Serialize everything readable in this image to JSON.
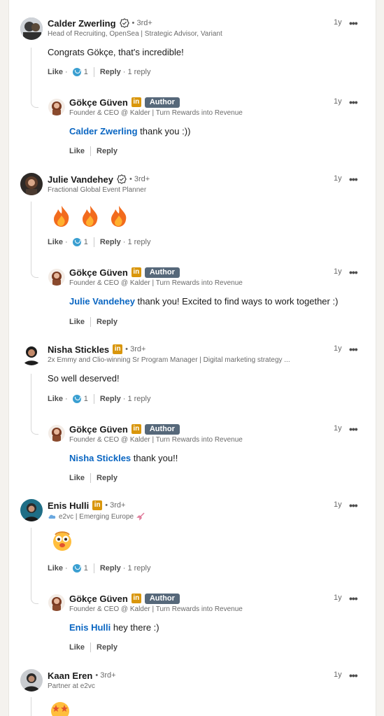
{
  "colors": {
    "link": "#0a66c2",
    "author_badge": "#56687a",
    "linkedin_badge": "#d9960b",
    "reaction": "#3a9fd1"
  },
  "labels": {
    "like": "Like",
    "reply": "Reply",
    "dot": "·",
    "bullet": "•",
    "author": "Author",
    "in": "in",
    "more": "•••"
  },
  "comments": [
    {
      "name": "Calder Zwerling",
      "degree": "3rd+",
      "badge": "verified-icon",
      "headline": "Head of Recruiting, OpenSea | Strategic Advisor, Variant",
      "time": "1y",
      "text": "Congrats Gökçe, that's incredible!",
      "reactions": "1",
      "replies": "1 reply",
      "reply": {
        "name": "Gökçe Güven",
        "headline": "Founder & CEO @ Kalder | Turn Rewards into Revenue",
        "time": "1y",
        "mention": "Calder Zwerling",
        "text": " thank you :))"
      }
    },
    {
      "name": "Julie Vandehey",
      "degree": "3rd+",
      "badge": "verified-icon",
      "headline": "Fractional Global Event Planner",
      "time": "1y",
      "emoji": "fire-emoji-x3",
      "reactions": "1",
      "replies": "1 reply",
      "reply": {
        "name": "Gökçe Güven",
        "headline": "Founder & CEO @ Kalder | Turn Rewards into Revenue",
        "time": "1y",
        "mention": "Julie Vandehey",
        "text": " thank you! Excited to find ways to work together :)"
      }
    },
    {
      "name": "Nisha Stickles",
      "degree": "3rd+",
      "badge": "linkedin-icon",
      "headline": "2x Emmy and Clio-winning Sr Program Manager | Digital marketing strategy ...",
      "time": "1y",
      "text": "So well deserved!",
      "reactions": "1",
      "replies": "1 reply",
      "reply": {
        "name": "Gökçe Güven",
        "headline": "Founder & CEO @ Kalder | Turn Rewards into Revenue",
        "time": "1y",
        "mention": "Nisha Stickles",
        "text": " thank you!!"
      }
    },
    {
      "name": "Enis Hulli",
      "degree": "3rd+",
      "badge": "linkedin-icon",
      "headline": "e2vc | Emerging Europe",
      "time": "1y",
      "emoji": "smiley-emoji",
      "reactions": "1",
      "replies": "1 reply",
      "reply": {
        "name": "Gökçe Güven",
        "headline": "Founder & CEO @ Kalder | Turn Rewards into Revenue",
        "time": "1y",
        "mention": "Enis Hulli",
        "text": " hey there :)"
      }
    },
    {
      "name": "Kaan Eren",
      "degree": "3rd+",
      "headline": "Partner at e2vc",
      "time": "1y",
      "emoji": "star-struck-emoji"
    }
  ]
}
